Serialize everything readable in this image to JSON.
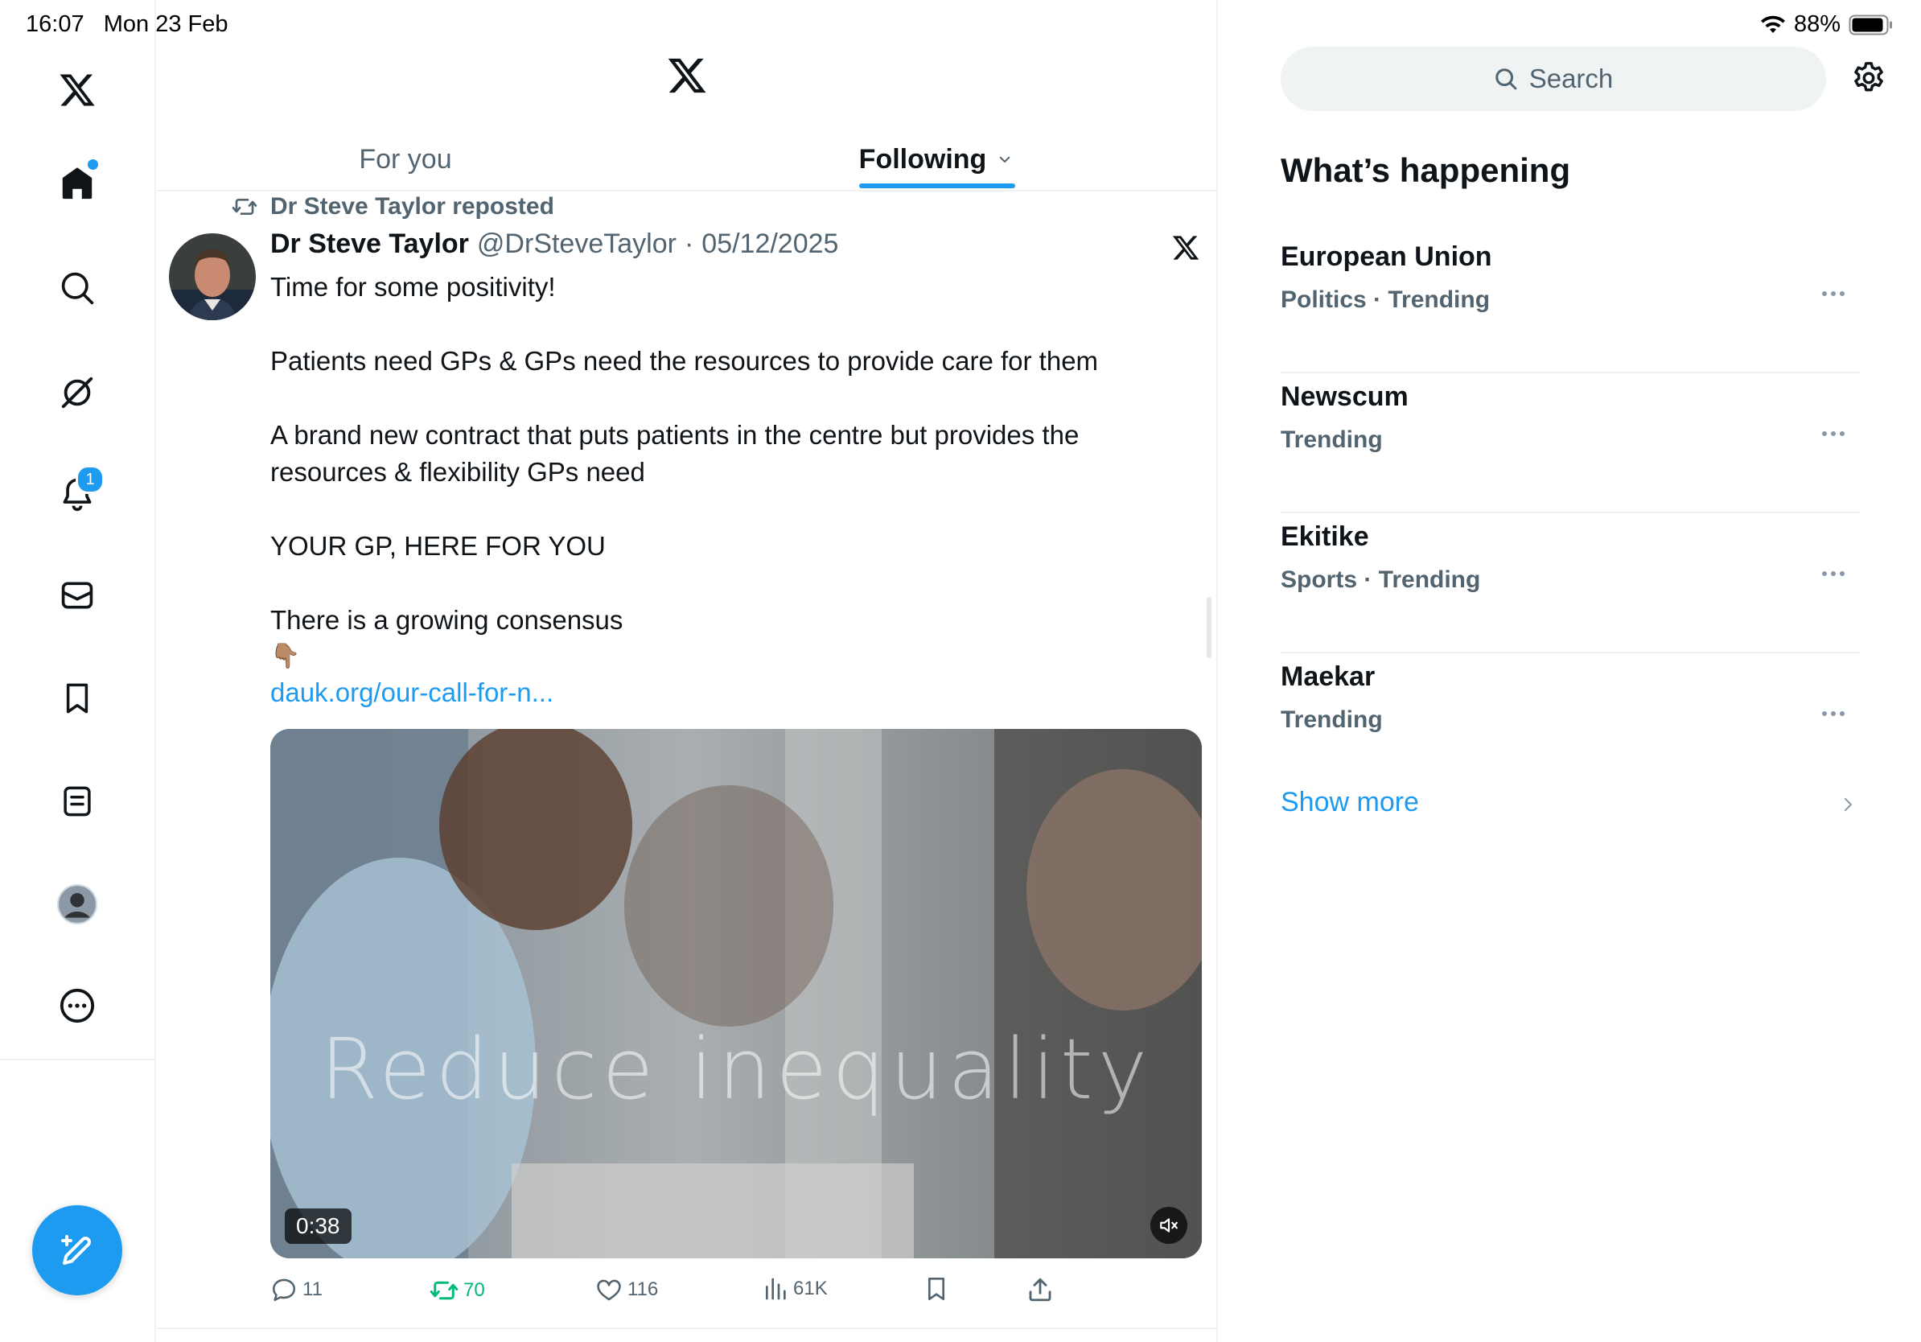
{
  "status_bar": {
    "time": "16:07",
    "date": "Mon 23 Feb",
    "battery": "88%"
  },
  "nav": {
    "items": [
      {
        "name": "x-logo"
      },
      {
        "name": "home"
      },
      {
        "name": "explore"
      },
      {
        "name": "grok"
      },
      {
        "name": "notifications",
        "badge": "1"
      },
      {
        "name": "messages"
      },
      {
        "name": "bookmarks"
      },
      {
        "name": "lists"
      },
      {
        "name": "profile"
      },
      {
        "name": "more"
      }
    ],
    "compose_icon": "compose-icon"
  },
  "header": {
    "tabs": [
      {
        "label": "For you",
        "active": false
      },
      {
        "label": "Following",
        "active": true
      }
    ]
  },
  "tweet": {
    "repost_label": "Dr Steve Taylor reposted",
    "author_name": "Dr Steve Taylor",
    "handle": "@DrSteveTaylor",
    "separator": "·",
    "date": "05/12/2025",
    "lines": {
      "l1": "Time for some positivity!",
      "l2": "Patients need GPs & GPs need the resources to provide care for them",
      "l3": "A brand new contract that puts patients in the centre but provides the resources & flexibility GPs need",
      "l4": "YOUR GP, HERE FOR YOU",
      "l5": "There is a growing consensus",
      "emoji": "👇🏽",
      "link": "dauk.org/our-call-for-n..."
    },
    "video": {
      "caption": "Reduce inequality",
      "duration": "0:38"
    },
    "stats": {
      "replies": "11",
      "reposts": "70",
      "likes": "116",
      "views": "61K"
    }
  },
  "sidebar": {
    "search_placeholder": "Search",
    "section_title": "What’s happening",
    "trends": [
      {
        "title": "European Union",
        "meta": "Politics · Trending"
      },
      {
        "title": "Newscum",
        "meta": "Trending"
      },
      {
        "title": "Ekitike",
        "meta": "Sports · Trending"
      },
      {
        "title": "Maekar",
        "meta": "Trending"
      }
    ],
    "show_more": "Show more"
  },
  "colors": {
    "accent": "#1d9bf0",
    "repost_green": "#00ba7c",
    "secondary_text": "#536471",
    "border": "#eff3f4"
  }
}
